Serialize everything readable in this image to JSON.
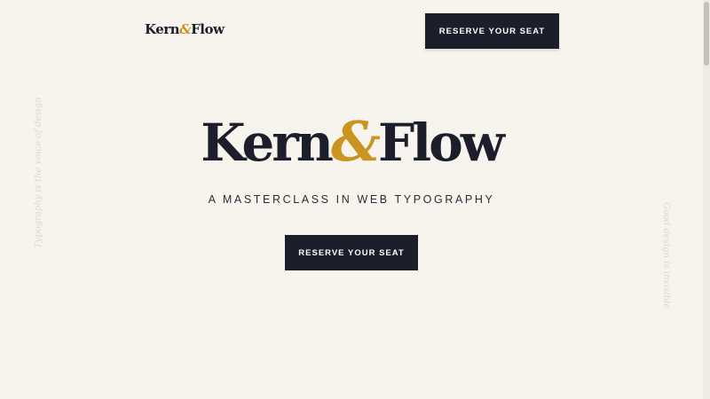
{
  "header": {
    "logo": {
      "left": "Kern",
      "amp": "&",
      "right": "Flow"
    },
    "cta_label": "RESERVE YOUR SEAT"
  },
  "hero": {
    "logo": {
      "left": "Kern",
      "amp": "&",
      "right": "Flow"
    },
    "tagline": "A MASTERCLASS IN WEB TYPOGRAPHY",
    "cta_label": "RESERVE YOUR SEAT"
  },
  "side_text": {
    "left": "Typography is the voice of design",
    "right": "Good design is invisible"
  },
  "colors": {
    "background": "#f7f4ee",
    "ink": "#1c1f2b",
    "accent": "#c9951f"
  }
}
